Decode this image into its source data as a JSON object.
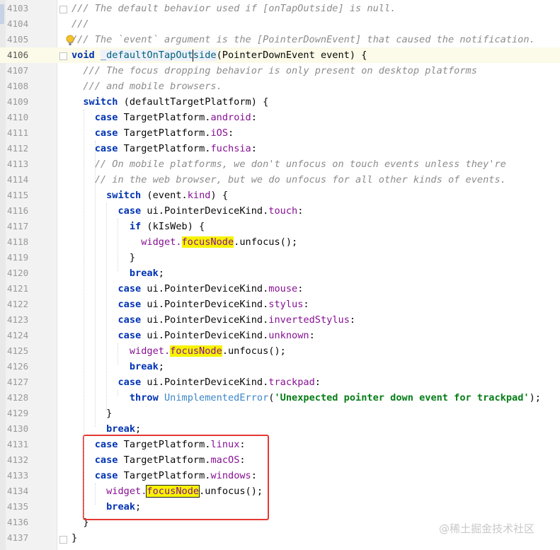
{
  "editor": {
    "current_line": "4106",
    "watermark": "@稀土掘金技术社区",
    "lines": [
      {
        "n": "4103",
        "seg": [
          {
            "t": "/// The default behavior used if [",
            "c": "cm"
          },
          {
            "t": "onTapOutside",
            "c": "cm"
          },
          {
            "t": "] is null.",
            "c": "cm"
          }
        ]
      },
      {
        "n": "4104",
        "seg": [
          {
            "t": "///",
            "c": "cm"
          }
        ]
      },
      {
        "n": "4105",
        "seg": [
          {
            "t": "/// The `event` argument is the [",
            "c": "cm"
          },
          {
            "t": "PointerDownEvent",
            "c": "cm"
          },
          {
            "t": "] that caused the notification.",
            "c": "cm"
          }
        ]
      },
      {
        "n": "4106",
        "seg": [
          {
            "t": "void ",
            "c": "kw"
          },
          {
            "t": "_defaultOnTapOut",
            "c": "fn fn-bg"
          },
          {
            "t": "|",
            "c": "caret"
          },
          {
            "t": "side",
            "c": "fn fn-bg"
          },
          {
            "t": "(PointerDownEvent event) {",
            "c": ""
          }
        ]
      },
      {
        "n": "4107",
        "seg": [
          {
            "t": "  /// The focus dropping behavior is only present on desktop platforms",
            "c": "cm"
          }
        ]
      },
      {
        "n": "4108",
        "seg": [
          {
            "t": "  /// and mobile browsers.",
            "c": "cm"
          }
        ]
      },
      {
        "n": "4109",
        "seg": [
          {
            "t": "  ",
            "c": ""
          },
          {
            "t": "switch",
            "c": "kw"
          },
          {
            "t": " (defaultTargetPlatform) {",
            "c": ""
          }
        ]
      },
      {
        "n": "4110",
        "seg": [
          {
            "t": "    ",
            "c": ""
          },
          {
            "t": "case",
            "c": "kw"
          },
          {
            "t": " TargetPlatform.",
            "c": ""
          },
          {
            "t": "android",
            "c": "fld"
          },
          {
            "t": ":",
            "c": ""
          }
        ]
      },
      {
        "n": "4111",
        "seg": [
          {
            "t": "    ",
            "c": ""
          },
          {
            "t": "case",
            "c": "kw"
          },
          {
            "t": " TargetPlatform.",
            "c": ""
          },
          {
            "t": "iOS",
            "c": "fld"
          },
          {
            "t": ":",
            "c": ""
          }
        ]
      },
      {
        "n": "4112",
        "seg": [
          {
            "t": "    ",
            "c": ""
          },
          {
            "t": "case",
            "c": "kw"
          },
          {
            "t": " TargetPlatform.",
            "c": ""
          },
          {
            "t": "fuchsia",
            "c": "fld"
          },
          {
            "t": ":",
            "c": ""
          }
        ]
      },
      {
        "n": "4113",
        "seg": [
          {
            "t": "    // On mobile platforms, we don't unfocus on touch events unless they're",
            "c": "cm"
          }
        ]
      },
      {
        "n": "4114",
        "seg": [
          {
            "t": "    // in the web browser, but we do unfocus for all other kinds of events.",
            "c": "cm"
          }
        ]
      },
      {
        "n": "4115",
        "seg": [
          {
            "t": "      ",
            "c": ""
          },
          {
            "t": "switch",
            "c": "kw"
          },
          {
            "t": " (event.",
            "c": ""
          },
          {
            "t": "kind",
            "c": "fld"
          },
          {
            "t": ") {",
            "c": ""
          }
        ]
      },
      {
        "n": "4116",
        "seg": [
          {
            "t": "        ",
            "c": ""
          },
          {
            "t": "case",
            "c": "kw"
          },
          {
            "t": " ui.PointerDeviceKind.",
            "c": ""
          },
          {
            "t": "touch",
            "c": "fld"
          },
          {
            "t": ":",
            "c": ""
          }
        ]
      },
      {
        "n": "4117",
        "seg": [
          {
            "t": "          ",
            "c": ""
          },
          {
            "t": "if",
            "c": "kw"
          },
          {
            "t": " (kIsWeb) {",
            "c": ""
          }
        ]
      },
      {
        "n": "4118",
        "seg": [
          {
            "t": "            widget.",
            "c": "fld"
          },
          {
            "t": "focusNode",
            "c": "fld-hl"
          },
          {
            "t": ".unfocus();",
            "c": ""
          }
        ]
      },
      {
        "n": "4119",
        "seg": [
          {
            "t": "          }",
            "c": ""
          }
        ]
      },
      {
        "n": "4120",
        "seg": [
          {
            "t": "          ",
            "c": ""
          },
          {
            "t": "break",
            "c": "kw"
          },
          {
            "t": ";",
            "c": ""
          }
        ]
      },
      {
        "n": "4121",
        "seg": [
          {
            "t": "        ",
            "c": ""
          },
          {
            "t": "case",
            "c": "kw"
          },
          {
            "t": " ui.PointerDeviceKind.",
            "c": ""
          },
          {
            "t": "mouse",
            "c": "fld"
          },
          {
            "t": ":",
            "c": ""
          }
        ]
      },
      {
        "n": "4122",
        "seg": [
          {
            "t": "        ",
            "c": ""
          },
          {
            "t": "case",
            "c": "kw"
          },
          {
            "t": " ui.PointerDeviceKind.",
            "c": ""
          },
          {
            "t": "stylus",
            "c": "fld"
          },
          {
            "t": ":",
            "c": ""
          }
        ]
      },
      {
        "n": "4123",
        "seg": [
          {
            "t": "        ",
            "c": ""
          },
          {
            "t": "case",
            "c": "kw"
          },
          {
            "t": " ui.PointerDeviceKind.",
            "c": ""
          },
          {
            "t": "invertedStylus",
            "c": "fld"
          },
          {
            "t": ":",
            "c": ""
          }
        ]
      },
      {
        "n": "4124",
        "seg": [
          {
            "t": "        ",
            "c": ""
          },
          {
            "t": "case",
            "c": "kw"
          },
          {
            "t": " ui.PointerDeviceKind.",
            "c": ""
          },
          {
            "t": "unknown",
            "c": "fld"
          },
          {
            "t": ":",
            "c": ""
          }
        ]
      },
      {
        "n": "4125",
        "seg": [
          {
            "t": "          widget.",
            "c": "fld"
          },
          {
            "t": "focusNode",
            "c": "fld-hl"
          },
          {
            "t": ".unfocus();",
            "c": ""
          }
        ]
      },
      {
        "n": "4126",
        "seg": [
          {
            "t": "          ",
            "c": ""
          },
          {
            "t": "break",
            "c": "kw"
          },
          {
            "t": ";",
            "c": ""
          }
        ]
      },
      {
        "n": "4127",
        "seg": [
          {
            "t": "        ",
            "c": ""
          },
          {
            "t": "case",
            "c": "kw"
          },
          {
            "t": " ui.PointerDeviceKind.",
            "c": ""
          },
          {
            "t": "trackpad",
            "c": "fld"
          },
          {
            "t": ":",
            "c": ""
          }
        ]
      },
      {
        "n": "4128",
        "seg": [
          {
            "t": "          ",
            "c": ""
          },
          {
            "t": "throw",
            "c": "kw"
          },
          {
            "t": " ",
            "c": ""
          },
          {
            "t": "UnimplementedError",
            "c": "cls"
          },
          {
            "t": "(",
            "c": ""
          },
          {
            "t": "'Unexpected pointer down event for trackpad'",
            "c": "str"
          },
          {
            "t": ");",
            "c": ""
          }
        ]
      },
      {
        "n": "4129",
        "seg": [
          {
            "t": "      }",
            "c": ""
          }
        ]
      },
      {
        "n": "4130",
        "seg": [
          {
            "t": "      ",
            "c": ""
          },
          {
            "t": "break",
            "c": "kw"
          },
          {
            "t": ";",
            "c": ""
          }
        ]
      },
      {
        "n": "4131",
        "seg": [
          {
            "t": "    ",
            "c": ""
          },
          {
            "t": "case",
            "c": "kw"
          },
          {
            "t": " TargetPlatform.",
            "c": ""
          },
          {
            "t": "linux",
            "c": "fld"
          },
          {
            "t": ":",
            "c": ""
          }
        ]
      },
      {
        "n": "4132",
        "seg": [
          {
            "t": "    ",
            "c": ""
          },
          {
            "t": "case",
            "c": "kw"
          },
          {
            "t": " TargetPlatform.",
            "c": ""
          },
          {
            "t": "macOS",
            "c": "fld"
          },
          {
            "t": ":",
            "c": ""
          }
        ]
      },
      {
        "n": "4133",
        "seg": [
          {
            "t": "    ",
            "c": ""
          },
          {
            "t": "case",
            "c": "kw"
          },
          {
            "t": " TargetPlatform.",
            "c": ""
          },
          {
            "t": "windows",
            "c": "fld"
          },
          {
            "t": ":",
            "c": ""
          }
        ]
      },
      {
        "n": "4134",
        "seg": [
          {
            "t": "      widget.",
            "c": "fld"
          },
          {
            "t": "focusNode",
            "c": "fld-hl sel-box"
          },
          {
            "t": ".unfocus();",
            "c": ""
          }
        ]
      },
      {
        "n": "4135",
        "seg": [
          {
            "t": "      ",
            "c": ""
          },
          {
            "t": "break",
            "c": "kw"
          },
          {
            "t": ";",
            "c": ""
          }
        ]
      },
      {
        "n": "4136",
        "seg": [
          {
            "t": "  }",
            "c": ""
          }
        ]
      },
      {
        "n": "4137",
        "seg": [
          {
            "t": "}",
            "c": ""
          }
        ]
      }
    ]
  },
  "colors": {
    "keyword": "#0033b3",
    "comment": "#8c8c8c",
    "field": "#871094",
    "string": "#067d17",
    "highlight": "#f6f300",
    "annotation_box": "#e53935"
  },
  "icons": [
    "lightbulb-icon",
    "fold-marker-icon"
  ]
}
